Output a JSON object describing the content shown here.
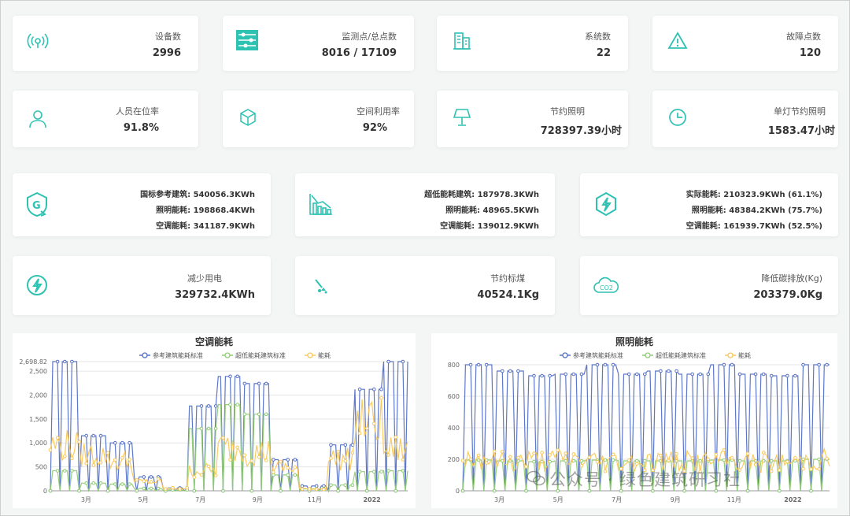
{
  "colors": {
    "accent": "#2ec2b3",
    "series_blue": "#5470c6",
    "series_green": "#91cc75",
    "series_yellow": "#fac858"
  },
  "row1": [
    {
      "label": "设备数",
      "value": "2996",
      "icon": "wifi-signal-icon"
    },
    {
      "label": "监测点/总点数",
      "value": "8016 / 17109",
      "icon": "sliders-icon"
    },
    {
      "label": "系统数",
      "value": "22",
      "icon": "building-icon"
    },
    {
      "label": "故障点数",
      "value": "120",
      "icon": "warning-icon"
    }
  ],
  "row2": [
    {
      "label": "人员在位率",
      "value": "91.8%",
      "icon": "person-icon"
    },
    {
      "label": "空间利用率",
      "value": "92%",
      "icon": "cube-icon"
    },
    {
      "label": "节约照明",
      "value": "728397.39小时",
      "icon": "lamp-icon"
    },
    {
      "label": "单灯节约照明",
      "value": "1583.47小时",
      "icon": "clock-icon"
    }
  ],
  "row3": [
    {
      "icon": "green-building-icon",
      "lines": [
        "国标参考建筑: 540056.3KWh",
        "照明能耗: 198868.4KWh",
        "空调能耗: 341187.9KWh"
      ]
    },
    {
      "icon": "bar-trend-icon",
      "lines": [
        "超低能耗建筑: 187978.3KWh",
        "照明能耗: 48965.5KWh",
        "空调能耗: 139012.9KWh"
      ]
    },
    {
      "icon": "lightning-hexagon-icon",
      "lines": [
        "实际能耗: 210323.9KWh (61.1%)",
        "照明能耗: 48384.2KWh (75.7%)",
        "空调能耗: 161939.7KWh (52.5%)"
      ]
    }
  ],
  "row4": [
    {
      "label": "减少用电",
      "value": "329732.4KWh",
      "icon": "electricity-icon"
    },
    {
      "label": "节约标煤",
      "value": "40524.1Kg",
      "icon": "coal-icon"
    },
    {
      "label": "降低碳排放(Kg)",
      "value": "203379.0Kg",
      "icon": "co2-cloud-icon"
    }
  ],
  "chart_data": [
    {
      "type": "line",
      "title": "空调能耗",
      "legend": [
        "参考建筑能耗标准",
        "超低能耗建筑标准",
        "能耗"
      ],
      "y_ticks": [
        "0",
        "500",
        "1,000",
        "1,500",
        "2,000",
        "2,500"
      ],
      "y_max_label": "2,698.82",
      "ylim": [
        0,
        2698.82
      ],
      "x_ticks": [
        "3月",
        "5月",
        "7月",
        "9月",
        "11月",
        "2022"
      ],
      "series": [
        {
          "name": "参考建筑能耗标准",
          "values": [
            2698,
            1150,
            1000,
            290,
            60,
            1770,
            2390,
            2240,
            650,
            100,
            960,
            2120,
            2698
          ]
        },
        {
          "name": "超低能耗建筑标准",
          "values": [
            420,
            160,
            140,
            50,
            20,
            1300,
            1800,
            1600,
            330,
            40,
            120,
            400,
            420
          ]
        },
        {
          "name": "能耗",
          "values": [
            1000,
            800,
            650,
            200,
            50,
            450,
            950,
            850,
            500,
            40,
            700,
            1500,
            900
          ]
        }
      ]
    },
    {
      "type": "line",
      "title": "照明能耗",
      "legend": [
        "参考建筑能耗标准",
        "超低能耗建筑标准",
        "能耗"
      ],
      "y_ticks": [
        "0",
        "200",
        "400",
        "600",
        "800"
      ],
      "ylim": [
        0,
        820
      ],
      "x_ticks": [
        "3月",
        "5月",
        "7月",
        "9月",
        "11月",
        "2022"
      ],
      "series": [
        {
          "name": "参考建筑能耗标准",
          "values": [
            800,
            760,
            730,
            740,
            800,
            740,
            760,
            740,
            800,
            740,
            730,
            800
          ]
        },
        {
          "name": "超低能耗建筑标准",
          "values": [
            195,
            190,
            185,
            190,
            195,
            190,
            190,
            190,
            195,
            190,
            190,
            200
          ]
        },
        {
          "name": "能耗",
          "values": [
            220,
            200,
            205,
            210,
            200,
            195,
            200,
            195,
            200,
            190,
            190,
            210
          ]
        }
      ]
    }
  ],
  "watermark": "公众号 · 绿色建筑研习社"
}
